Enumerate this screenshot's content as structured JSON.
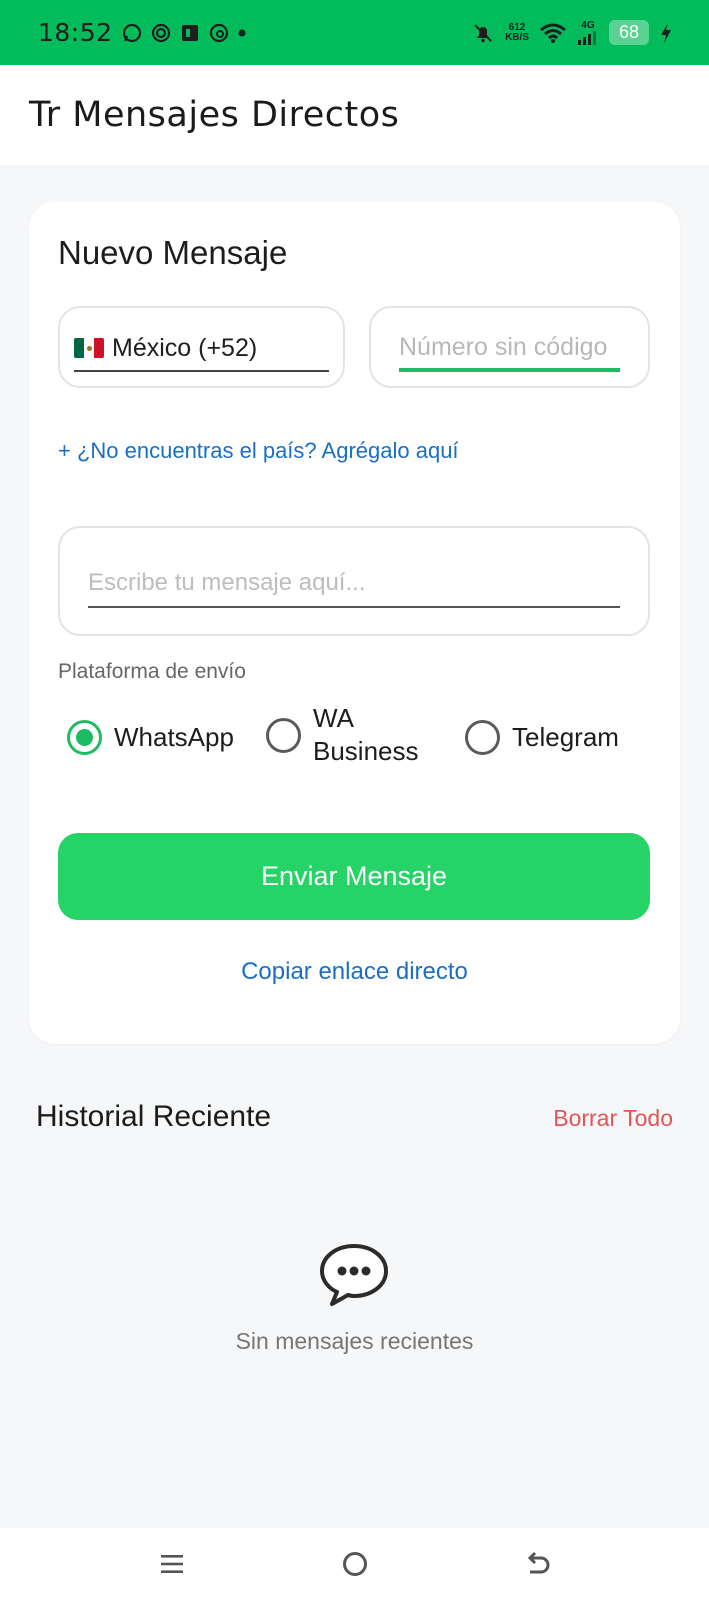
{
  "status_bar": {
    "time": "18:52",
    "net_speed_top": "612",
    "net_speed_bottom": "KB/S",
    "network": "4G",
    "battery": "68"
  },
  "app_bar": {
    "title": "Tr Mensajes Directos"
  },
  "card": {
    "title": "Nuevo Mensaje",
    "country_selector": {
      "flag": "mexico-flag",
      "value": "México (+52)"
    },
    "phone_placeholder": "Número sin código",
    "add_country_link": "+ ¿No encuentras el país? Agrégalo aquí",
    "message_placeholder": "Escribe tu mensaje aquí...",
    "platform_label": "Plataforma de envío",
    "platforms": [
      {
        "label": "WhatsApp",
        "selected": true
      },
      {
        "label_line1": "WA",
        "label_line2": "Business",
        "selected": false
      },
      {
        "label": "Telegram",
        "selected": false
      }
    ],
    "send_button": "Enviar Mensaje",
    "copy_link": "Copiar enlace directo"
  },
  "history": {
    "title": "Historial Reciente",
    "clear_all": "Borrar Todo",
    "empty_text": "Sin mensajes recientes",
    "empty_icon": "chat-bubble-icon"
  },
  "colors": {
    "status_bar": "#02bb5a",
    "accent": "#25d366",
    "link": "#1a6fc4",
    "danger": "#e05656"
  }
}
